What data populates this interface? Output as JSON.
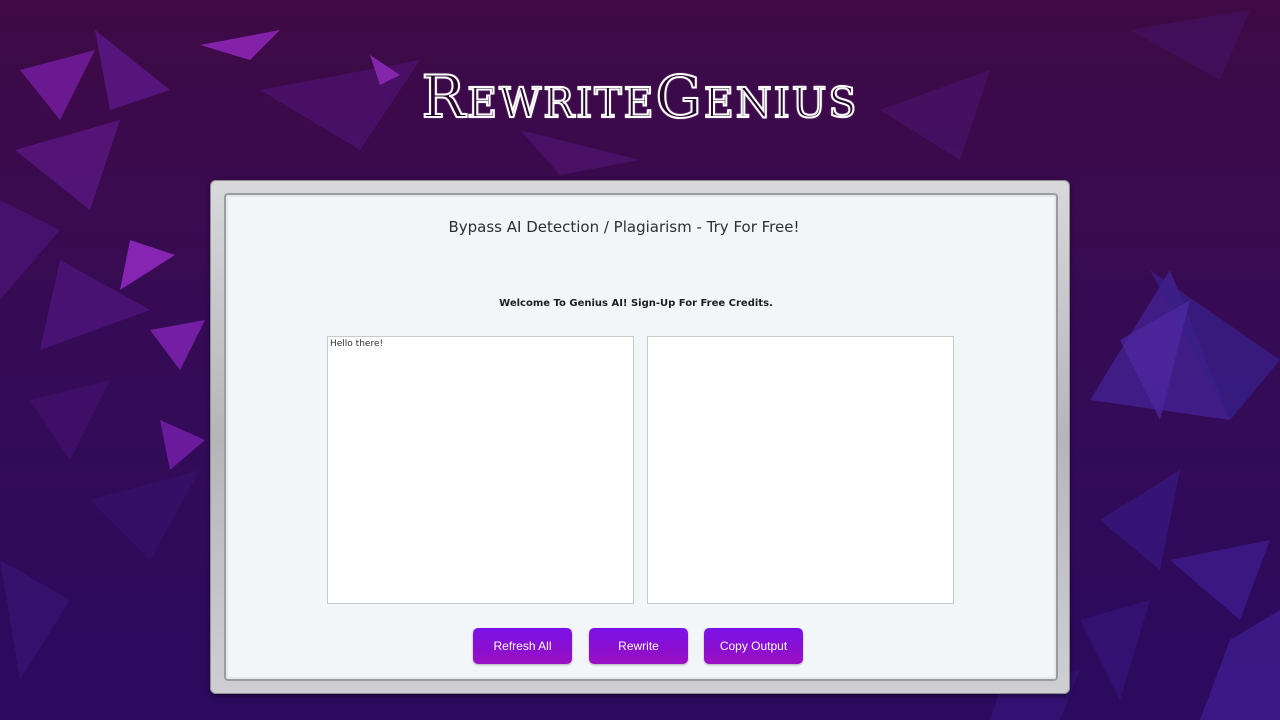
{
  "logo": {
    "text": "RewriteGenius"
  },
  "panel": {
    "headline": "Bypass AI Detection / Plagiarism - Try For Free!",
    "welcome": "Welcome To Genius AI! Sign-Up For Free Credits."
  },
  "editor": {
    "input_value": "Hello there!",
    "output_value": ""
  },
  "buttons": {
    "refresh": "Refresh All",
    "rewrite": "Rewrite",
    "copy": "Copy Output"
  },
  "colors": {
    "background_top": "#3f0a45",
    "background_bottom": "#2b0a5f",
    "panel": "#f3f6f9",
    "button_accent": "#8a0fd0"
  }
}
